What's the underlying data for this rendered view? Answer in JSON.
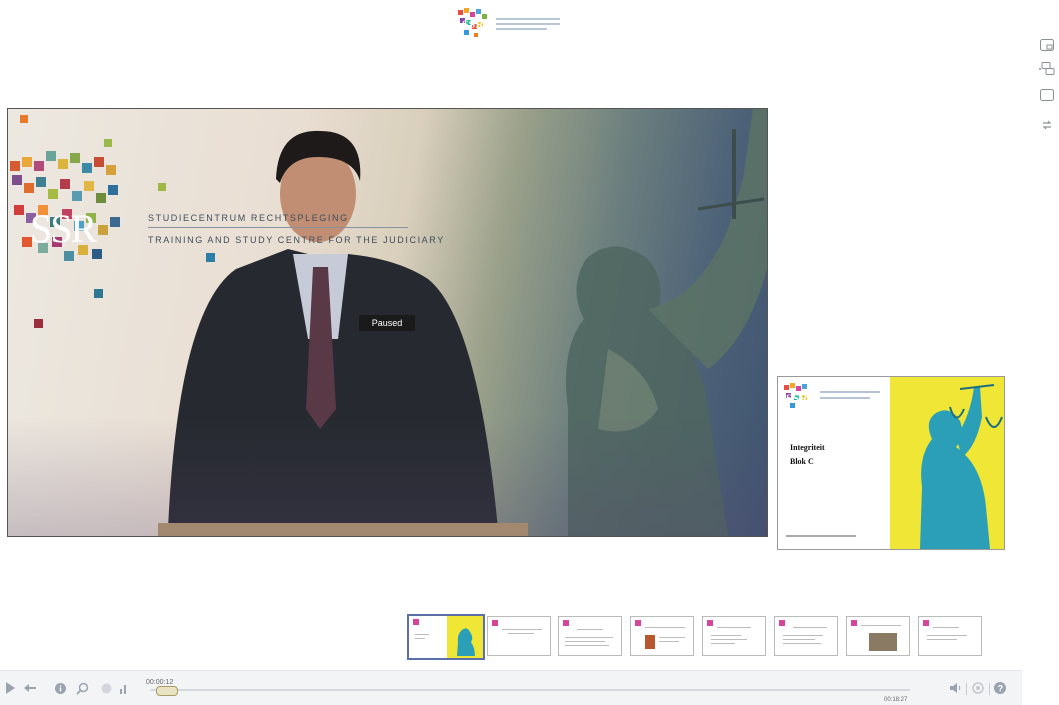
{
  "video": {
    "brand_line1": "STUDIECENTRUM RECHTSPLEGING",
    "brand_line2": "TRAINING AND STUDY CENTRE FOR THE JUDICIARY",
    "brand_logo_text": "SSR",
    "status": "Paused"
  },
  "slide_preview": {
    "logo_text": "SSR",
    "title_line1": "Integriteit",
    "title_line2": "Blok C"
  },
  "player": {
    "current_time": "00:00:12",
    "total_time": "00:18:27",
    "progress_fraction": 0.011
  },
  "thumbnails": {
    "count": 8,
    "active_index": 0
  },
  "colors": {
    "accent": "#5b6fa8",
    "slide_yellow": "#efe636",
    "paused_bg": "#1a1a1a"
  },
  "icons": {
    "side": [
      "picture-in-picture-icon",
      "swap-layout-icon",
      "single-view-icon",
      "refresh-icon"
    ],
    "controls_left": [
      "play-icon",
      "rewind-icon",
      "info-icon",
      "search-icon",
      "caption-icon",
      "bars-icon"
    ],
    "controls_right": [
      "volume-icon",
      "settings-icon",
      "help-icon"
    ]
  }
}
